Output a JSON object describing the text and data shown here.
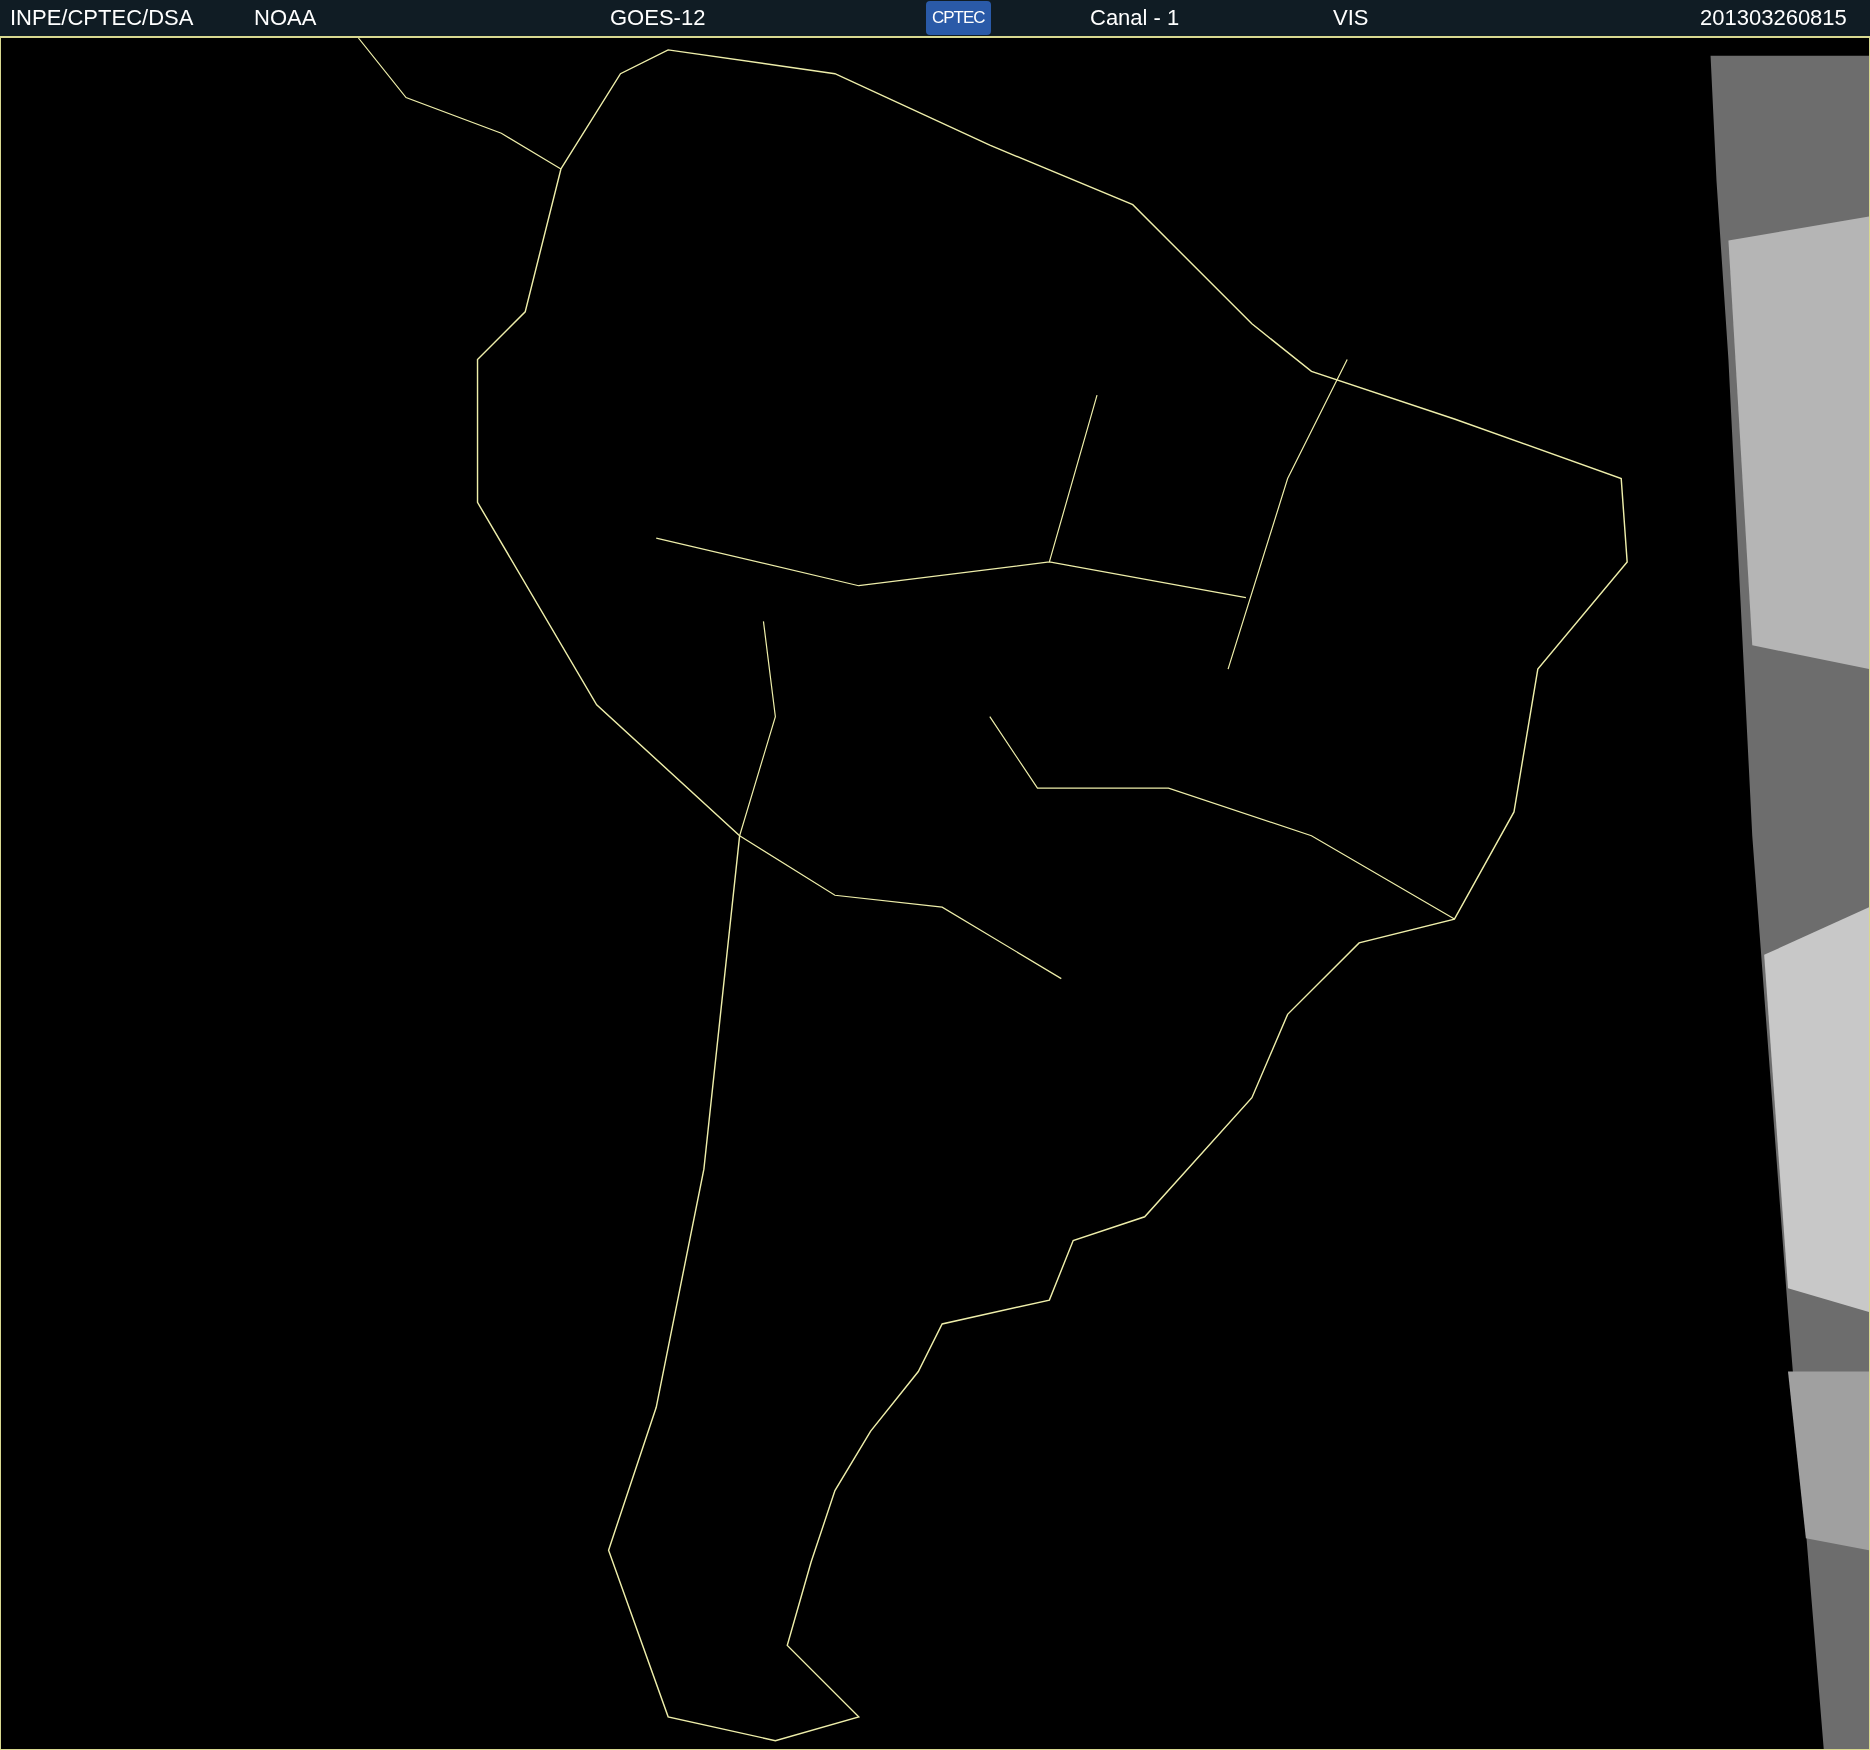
{
  "header": {
    "items": [
      {
        "kind": "text",
        "text": "INPE/CPTEC/DSA"
      },
      {
        "kind": "text",
        "text": "NOAA"
      },
      {
        "kind": "text",
        "text": "GOES-12"
      },
      {
        "kind": "logo",
        "text": "CPTEC"
      },
      {
        "kind": "text",
        "text": "Canal - 1"
      },
      {
        "kind": "text",
        "text": "VIS"
      },
      {
        "kind": "text",
        "text": "201303260815"
      }
    ]
  }
}
